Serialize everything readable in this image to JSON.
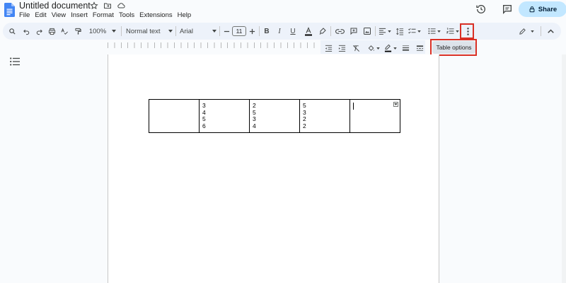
{
  "header": {
    "title": "Untitled document",
    "menu": [
      "File",
      "Edit",
      "View",
      "Insert",
      "Format",
      "Tools",
      "Extensions",
      "Help"
    ],
    "share_label": "Share"
  },
  "toolbar": {
    "zoom": "100%",
    "style": "Normal text",
    "font": "Arial",
    "font_size": "11"
  },
  "table_options": {
    "label": "Table options"
  },
  "table": {
    "rows": [
      [
        {
          "lines": []
        },
        {
          "lines": [
            "3",
            "4",
            "5",
            "6"
          ]
        },
        {
          "lines": [
            "2",
            "5",
            "3",
            "4"
          ]
        },
        {
          "lines": [
            "5",
            "3",
            "2",
            "2"
          ]
        },
        {
          "lines": [],
          "cursor": true
        }
      ]
    ]
  },
  "colors": {
    "share_bg": "#c2e7ff",
    "toolbar_bg": "#edf2fa",
    "highlight_red": "#d93025",
    "docs_blue": "#4285f4"
  }
}
